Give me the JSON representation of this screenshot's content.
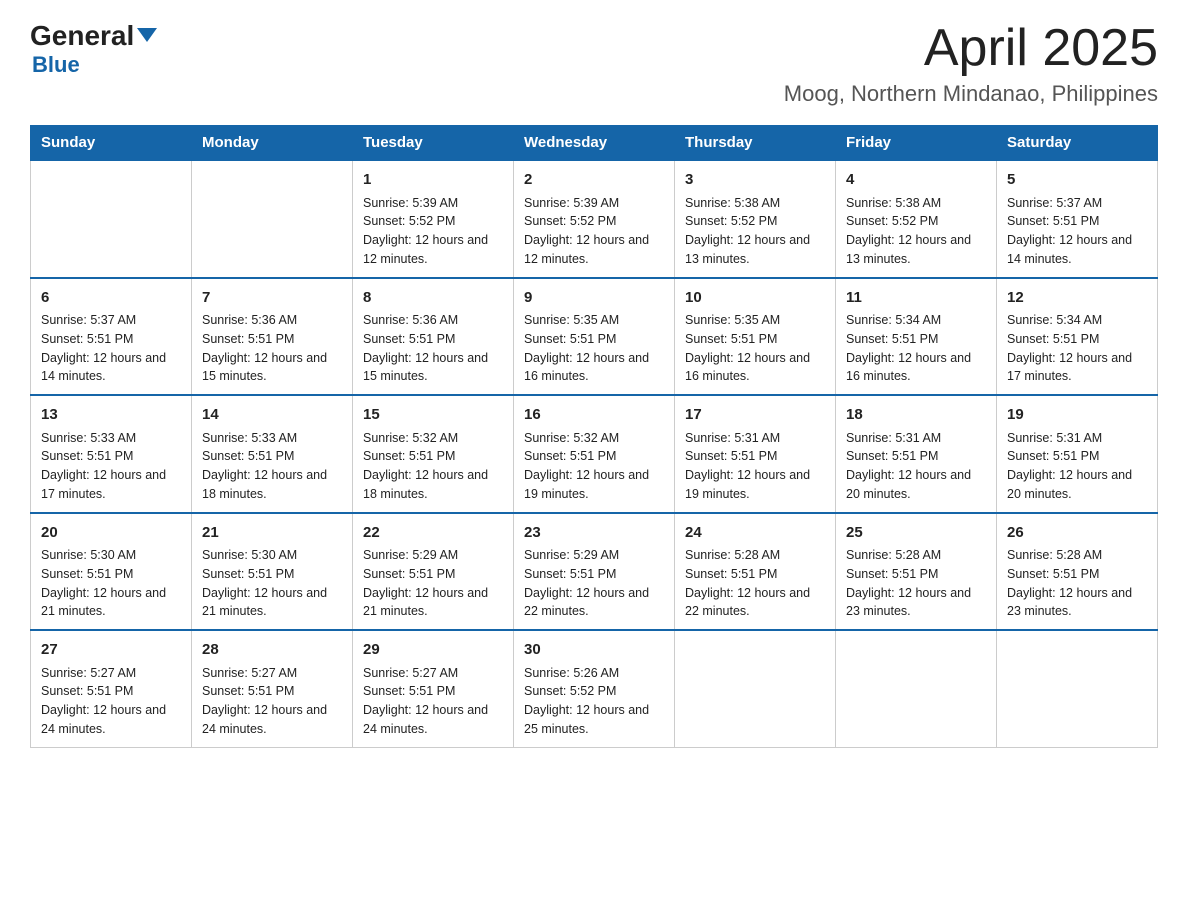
{
  "header": {
    "logo_general": "General",
    "logo_blue": "Blue",
    "title": "April 2025",
    "subtitle": "Moog, Northern Mindanao, Philippines"
  },
  "days_of_week": [
    "Sunday",
    "Monday",
    "Tuesday",
    "Wednesday",
    "Thursday",
    "Friday",
    "Saturday"
  ],
  "weeks": [
    [
      {
        "day": "",
        "sunrise": "",
        "sunset": "",
        "daylight": ""
      },
      {
        "day": "",
        "sunrise": "",
        "sunset": "",
        "daylight": ""
      },
      {
        "day": "1",
        "sunrise": "Sunrise: 5:39 AM",
        "sunset": "Sunset: 5:52 PM",
        "daylight": "Daylight: 12 hours and 12 minutes."
      },
      {
        "day": "2",
        "sunrise": "Sunrise: 5:39 AM",
        "sunset": "Sunset: 5:52 PM",
        "daylight": "Daylight: 12 hours and 12 minutes."
      },
      {
        "day": "3",
        "sunrise": "Sunrise: 5:38 AM",
        "sunset": "Sunset: 5:52 PM",
        "daylight": "Daylight: 12 hours and 13 minutes."
      },
      {
        "day": "4",
        "sunrise": "Sunrise: 5:38 AM",
        "sunset": "Sunset: 5:52 PM",
        "daylight": "Daylight: 12 hours and 13 minutes."
      },
      {
        "day": "5",
        "sunrise": "Sunrise: 5:37 AM",
        "sunset": "Sunset: 5:51 PM",
        "daylight": "Daylight: 12 hours and 14 minutes."
      }
    ],
    [
      {
        "day": "6",
        "sunrise": "Sunrise: 5:37 AM",
        "sunset": "Sunset: 5:51 PM",
        "daylight": "Daylight: 12 hours and 14 minutes."
      },
      {
        "day": "7",
        "sunrise": "Sunrise: 5:36 AM",
        "sunset": "Sunset: 5:51 PM",
        "daylight": "Daylight: 12 hours and 15 minutes."
      },
      {
        "day": "8",
        "sunrise": "Sunrise: 5:36 AM",
        "sunset": "Sunset: 5:51 PM",
        "daylight": "Daylight: 12 hours and 15 minutes."
      },
      {
        "day": "9",
        "sunrise": "Sunrise: 5:35 AM",
        "sunset": "Sunset: 5:51 PM",
        "daylight": "Daylight: 12 hours and 16 minutes."
      },
      {
        "day": "10",
        "sunrise": "Sunrise: 5:35 AM",
        "sunset": "Sunset: 5:51 PM",
        "daylight": "Daylight: 12 hours and 16 minutes."
      },
      {
        "day": "11",
        "sunrise": "Sunrise: 5:34 AM",
        "sunset": "Sunset: 5:51 PM",
        "daylight": "Daylight: 12 hours and 16 minutes."
      },
      {
        "day": "12",
        "sunrise": "Sunrise: 5:34 AM",
        "sunset": "Sunset: 5:51 PM",
        "daylight": "Daylight: 12 hours and 17 minutes."
      }
    ],
    [
      {
        "day": "13",
        "sunrise": "Sunrise: 5:33 AM",
        "sunset": "Sunset: 5:51 PM",
        "daylight": "Daylight: 12 hours and 17 minutes."
      },
      {
        "day": "14",
        "sunrise": "Sunrise: 5:33 AM",
        "sunset": "Sunset: 5:51 PM",
        "daylight": "Daylight: 12 hours and 18 minutes."
      },
      {
        "day": "15",
        "sunrise": "Sunrise: 5:32 AM",
        "sunset": "Sunset: 5:51 PM",
        "daylight": "Daylight: 12 hours and 18 minutes."
      },
      {
        "day": "16",
        "sunrise": "Sunrise: 5:32 AM",
        "sunset": "Sunset: 5:51 PM",
        "daylight": "Daylight: 12 hours and 19 minutes."
      },
      {
        "day": "17",
        "sunrise": "Sunrise: 5:31 AM",
        "sunset": "Sunset: 5:51 PM",
        "daylight": "Daylight: 12 hours and 19 minutes."
      },
      {
        "day": "18",
        "sunrise": "Sunrise: 5:31 AM",
        "sunset": "Sunset: 5:51 PM",
        "daylight": "Daylight: 12 hours and 20 minutes."
      },
      {
        "day": "19",
        "sunrise": "Sunrise: 5:31 AM",
        "sunset": "Sunset: 5:51 PM",
        "daylight": "Daylight: 12 hours and 20 minutes."
      }
    ],
    [
      {
        "day": "20",
        "sunrise": "Sunrise: 5:30 AM",
        "sunset": "Sunset: 5:51 PM",
        "daylight": "Daylight: 12 hours and 21 minutes."
      },
      {
        "day": "21",
        "sunrise": "Sunrise: 5:30 AM",
        "sunset": "Sunset: 5:51 PM",
        "daylight": "Daylight: 12 hours and 21 minutes."
      },
      {
        "day": "22",
        "sunrise": "Sunrise: 5:29 AM",
        "sunset": "Sunset: 5:51 PM",
        "daylight": "Daylight: 12 hours and 21 minutes."
      },
      {
        "day": "23",
        "sunrise": "Sunrise: 5:29 AM",
        "sunset": "Sunset: 5:51 PM",
        "daylight": "Daylight: 12 hours and 22 minutes."
      },
      {
        "day": "24",
        "sunrise": "Sunrise: 5:28 AM",
        "sunset": "Sunset: 5:51 PM",
        "daylight": "Daylight: 12 hours and 22 minutes."
      },
      {
        "day": "25",
        "sunrise": "Sunrise: 5:28 AM",
        "sunset": "Sunset: 5:51 PM",
        "daylight": "Daylight: 12 hours and 23 minutes."
      },
      {
        "day": "26",
        "sunrise": "Sunrise: 5:28 AM",
        "sunset": "Sunset: 5:51 PM",
        "daylight": "Daylight: 12 hours and 23 minutes."
      }
    ],
    [
      {
        "day": "27",
        "sunrise": "Sunrise: 5:27 AM",
        "sunset": "Sunset: 5:51 PM",
        "daylight": "Daylight: 12 hours and 24 minutes."
      },
      {
        "day": "28",
        "sunrise": "Sunrise: 5:27 AM",
        "sunset": "Sunset: 5:51 PM",
        "daylight": "Daylight: 12 hours and 24 minutes."
      },
      {
        "day": "29",
        "sunrise": "Sunrise: 5:27 AM",
        "sunset": "Sunset: 5:51 PM",
        "daylight": "Daylight: 12 hours and 24 minutes."
      },
      {
        "day": "30",
        "sunrise": "Sunrise: 5:26 AM",
        "sunset": "Sunset: 5:52 PM",
        "daylight": "Daylight: 12 hours and 25 minutes."
      },
      {
        "day": "",
        "sunrise": "",
        "sunset": "",
        "daylight": ""
      },
      {
        "day": "",
        "sunrise": "",
        "sunset": "",
        "daylight": ""
      },
      {
        "day": "",
        "sunrise": "",
        "sunset": "",
        "daylight": ""
      }
    ]
  ]
}
